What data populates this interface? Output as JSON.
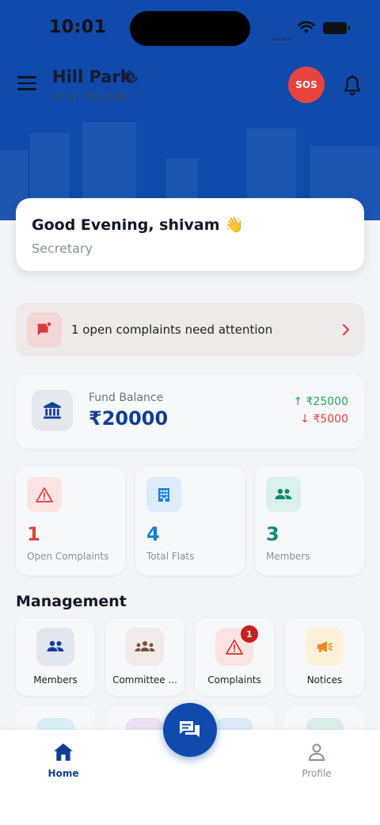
{
  "status_bar": {
    "time": "10:01"
  },
  "header": {
    "society_name": "Hill Park",
    "location": "virar, Mumbai",
    "sos_label": "SOS"
  },
  "greeting": {
    "text": "Good Evening, shivam 👋",
    "role": "Secretary"
  },
  "alert": {
    "text": "1 open complaints need attention"
  },
  "fund": {
    "label": "Fund Balance",
    "balance": "₹20000",
    "income": "↑ ₹25000",
    "expense": "↓ ₹5000"
  },
  "stats": [
    {
      "value": "1",
      "label": "Open Complaints",
      "icon": "warning-icon",
      "color": "#e0453e"
    },
    {
      "value": "4",
      "label": "Total Flats",
      "icon": "building-icon",
      "color": "#1a7fd4"
    },
    {
      "value": "3",
      "label": "Members",
      "icon": "people-icon",
      "color": "#0f8a7a"
    }
  ],
  "management": {
    "title": "Management",
    "items": [
      {
        "label": "Members",
        "icon": "people-icon"
      },
      {
        "label": "Committee ...",
        "icon": "committee-icon"
      },
      {
        "label": "Complaints",
        "icon": "warning-icon",
        "badge": "1"
      },
      {
        "label": "Notices",
        "icon": "megaphone-icon"
      }
    ]
  },
  "bottom_nav": {
    "home": "Home",
    "profile": "Profile"
  },
  "colors": {
    "brand": "#0f4aac",
    "danger": "#e0453e",
    "success": "#22a55a"
  }
}
